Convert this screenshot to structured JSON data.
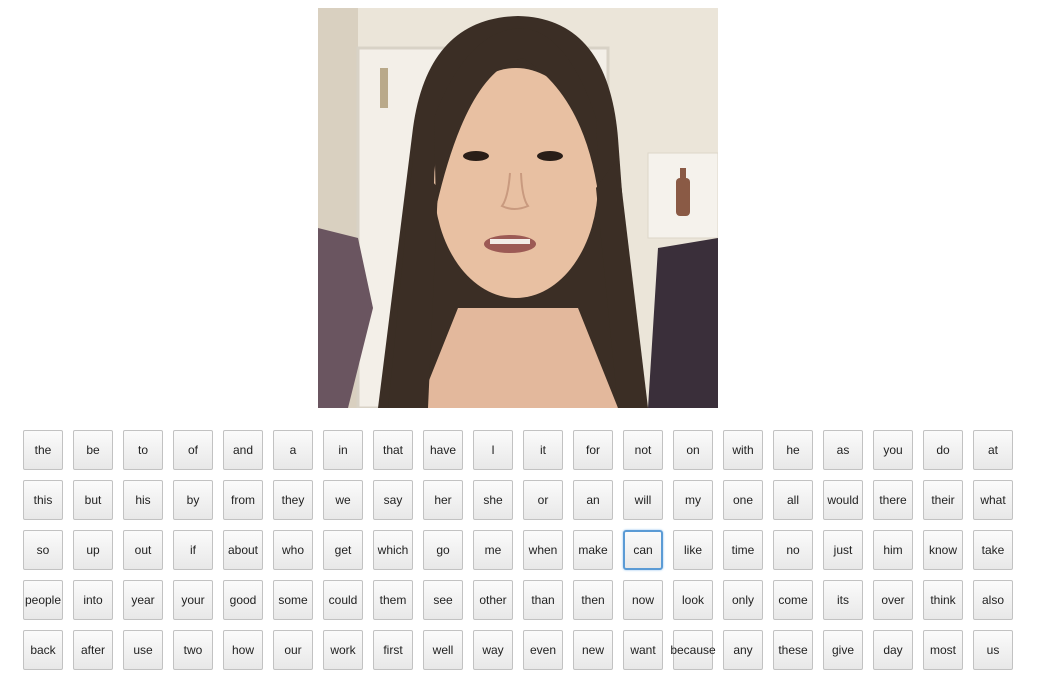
{
  "video": {
    "description_icon": "person-speaking-video-frame"
  },
  "focused_word": "can",
  "rows": [
    [
      "the",
      "be",
      "to",
      "of",
      "and",
      "a",
      "in",
      "that",
      "have",
      "I",
      "it",
      "for",
      "not",
      "on",
      "with",
      "he",
      "as",
      "you",
      "do",
      "at"
    ],
    [
      "this",
      "but",
      "his",
      "by",
      "from",
      "they",
      "we",
      "say",
      "her",
      "she",
      "or",
      "an",
      "will",
      "my",
      "one",
      "all",
      "would",
      "there",
      "their",
      "what"
    ],
    [
      "so",
      "up",
      "out",
      "if",
      "about",
      "who",
      "get",
      "which",
      "go",
      "me",
      "when",
      "make",
      "can",
      "like",
      "time",
      "no",
      "just",
      "him",
      "know",
      "take"
    ],
    [
      "people",
      "into",
      "year",
      "your",
      "good",
      "some",
      "could",
      "them",
      "see",
      "other",
      "than",
      "then",
      "now",
      "look",
      "only",
      "come",
      "its",
      "over",
      "think",
      "also"
    ],
    [
      "back",
      "after",
      "use",
      "two",
      "how",
      "our",
      "work",
      "first",
      "well",
      "way",
      "even",
      "new",
      "want",
      "because",
      "any",
      "these",
      "give",
      "day",
      "most",
      "us"
    ]
  ]
}
